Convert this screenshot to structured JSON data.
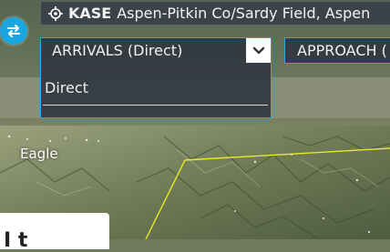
{
  "header": {
    "airport_code": "KASE",
    "airport_name": "Aspen-Pitkin Co/Sardy Field, Aspen"
  },
  "procedures": {
    "arrivals_label": "ARRIVALS (Direct)",
    "approach_label": "APPROACH (",
    "dropdown_options": [
      "Direct"
    ]
  },
  "map": {
    "place_labels": [
      "Eagle"
    ],
    "route_color": "#e8e82a"
  },
  "info_card": {
    "text": "I  t"
  },
  "colors": {
    "accent": "#1aa7e0",
    "panel": "#323840"
  },
  "icons": {
    "airport": "location-target-icon",
    "swap": "swap-arrows-icon",
    "dropdown": "chevron-down-icon"
  }
}
